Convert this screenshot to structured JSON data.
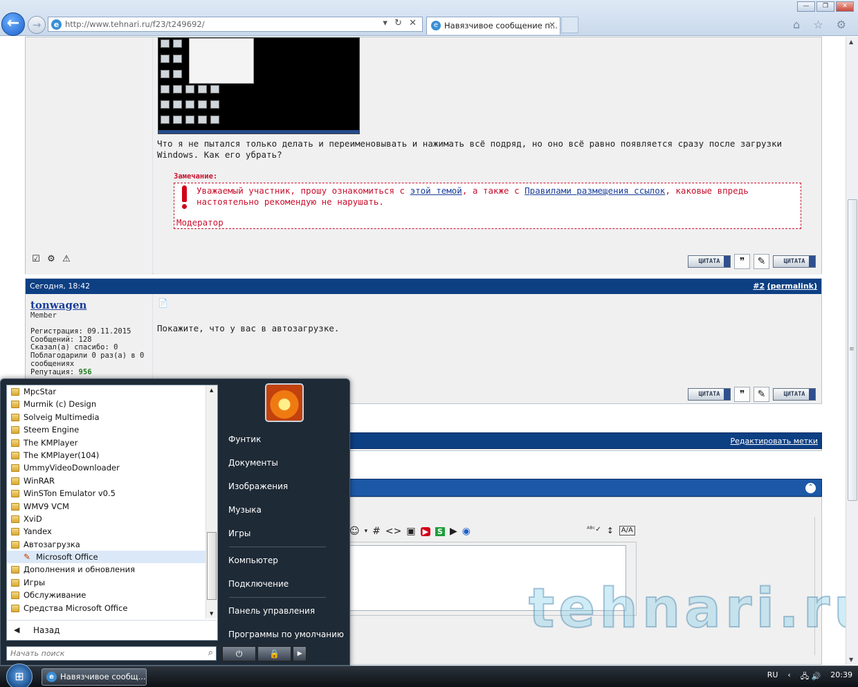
{
  "browser": {
    "back": "←",
    "forward": "→",
    "url": "http://www.tehnari.ru/f23/t249692/",
    "address_controls": "▾ ↻ ✕",
    "favicon": "e",
    "tab_title": "Навязчивое сообщение п...",
    "tab_close": "✕",
    "window_buttons": [
      "—",
      "❐",
      "✕"
    ],
    "tools": "⌂ ☆ ⚙"
  },
  "post1": {
    "text": "Что я не пытался только делать и переименовывать и нажимать всё подряд, но оно всё равно появляется сразу после загрузки Windows. Как его убрать?",
    "remark_label": "Замечание:",
    "remark_text_1": "Уважаемый участник, прошу ознакомиться с ",
    "remark_link_1": "этой темой",
    "remark_text_2": ", а также с ",
    "remark_link_2": "Правилами размещения ссылок",
    "remark_text_3": ", каковые впредь настоятельно рекомендую не нарушать.",
    "moderator": "Модератор",
    "post_icons": [
      "☑",
      "⚙",
      "⚠"
    ],
    "quote_btn": "ЦИТАТА",
    "multiquote_btn": "ЦИТАТА"
  },
  "post2": {
    "date": "Сегодня, 18:42",
    "post_number": "#2",
    "permalink": "(permalink)",
    "username": "tonwagen",
    "rank": "Member",
    "reg": "Регистрация: 09.11.2015",
    "posts": "Сообщений: 128",
    "thanks_said": "Сказал(а) спасибо: 0",
    "thanked": "Поблагодарили 0 раз(а) в 0 сообщениях",
    "rep_label": "Репутация: ",
    "rep_value": "956",
    "post_icon": "📄",
    "text": "Покажите, что у вас в автозагрузке.",
    "quote_btn": "ЦИТАТА",
    "multiquote_btn": "ЦИТАТА"
  },
  "tags": {
    "edit_tags": "Редактировать метки"
  },
  "editor": {
    "tools": [
      "☺",
      "▾",
      "#",
      "<>",
      "▣",
      "▶",
      "S",
      "▶",
      "◉"
    ],
    "spell": "ᴬᴮᶜ✓",
    "resize": "↕",
    "switch": "A/A"
  },
  "watermark": "tehnari.ru",
  "start_menu": {
    "programs": [
      {
        "label": "MpcStar"
      },
      {
        "label": "Murmik (c) Design"
      },
      {
        "label": "Solveig Multimedia"
      },
      {
        "label": "Steem Engine"
      },
      {
        "label": "The KMPlayer"
      },
      {
        "label": "The KMPlayer(104)"
      },
      {
        "label": "UmmyVideoDownloader"
      },
      {
        "label": "WinRAR"
      },
      {
        "label": "WinSTon Emulator v0.5"
      },
      {
        "label": "WMV9 VCM"
      },
      {
        "label": "XviD"
      },
      {
        "label": "Yandex"
      },
      {
        "label": "Автозагрузка"
      },
      {
        "label": "Microsoft Office"
      },
      {
        "label": "Дополнения и обновления"
      },
      {
        "label": "Игры"
      },
      {
        "label": "Обслуживание"
      },
      {
        "label": "Средства Microsoft Office"
      }
    ],
    "back_label": "Назад",
    "back_arrow": "◀",
    "search_placeholder": "Начать поиск",
    "search_icon": "⌕",
    "right_items": [
      "Фунтик",
      "Документы",
      "Изображения",
      "Музыка",
      "Игры",
      "Компьютер",
      "Подключение",
      "Панель управления",
      "Программы по умолчанию"
    ],
    "power_icon": "⏻",
    "lock_icon": "🔒",
    "more_icon": "▶"
  },
  "taskbar": {
    "start_icon": "⊞",
    "task_label": "Навязчивое сообщ...",
    "lang": "RU",
    "tray_arrow": "‹",
    "tray_icons": "🖧 🔊",
    "clock": "20:39"
  }
}
